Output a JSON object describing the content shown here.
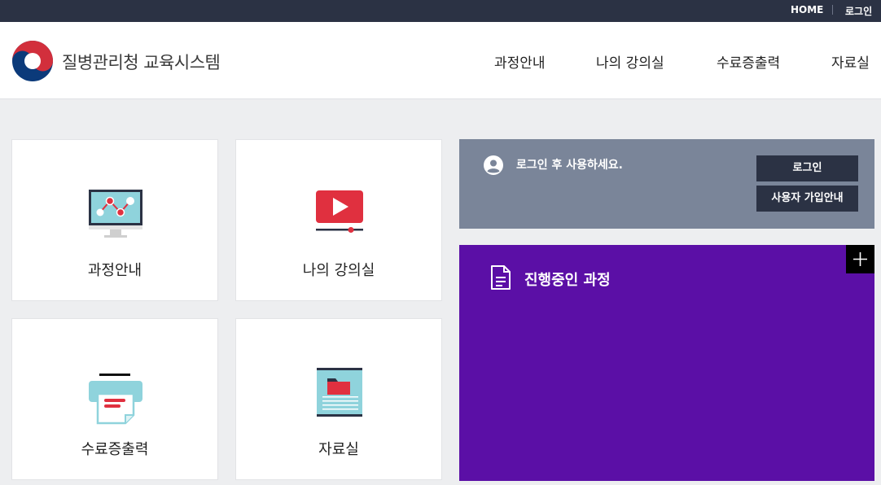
{
  "topbar": {
    "home_label": "HOME",
    "login_label": "로그인"
  },
  "header": {
    "brand": "질병관리청 교육시스템",
    "nav": [
      "과정안내",
      "나의 강의실",
      "수료증출력",
      "자료실"
    ]
  },
  "tiles": [
    {
      "label": "과정안내",
      "icon": "monitor-chart-icon"
    },
    {
      "label": "나의 강의실",
      "icon": "video-play-icon"
    },
    {
      "label": "수료증출력",
      "icon": "printer-icon"
    },
    {
      "label": "자료실",
      "icon": "folder-document-icon"
    }
  ],
  "login_panel": {
    "message": "로그인 후 사용하세요.",
    "login_button": "로그인",
    "signup_button": "사용자 가입안내"
  },
  "course_panel": {
    "title": "진행중인 과정"
  },
  "colors": {
    "topbar": "#2b3244",
    "login_panel": "#7a8599",
    "course_panel": "#5b0fa6",
    "accent_red": "#e0303f",
    "accent_teal": "#8fd3dc"
  }
}
